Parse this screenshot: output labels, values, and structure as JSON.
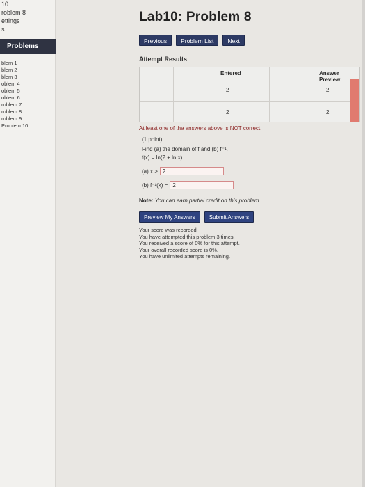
{
  "sidebar": {
    "top_lines": [
      "10",
      "roblem 8",
      "ettings",
      "s"
    ],
    "problems_header": "Problems",
    "items": [
      "blem 1",
      "blem 2",
      "blem 3",
      "oblem 4",
      "oblem 5",
      "oblem 6",
      "roblem 7",
      "roblem 8",
      "roblem 9",
      "Problem 10"
    ]
  },
  "main": {
    "title": "Lab10: Problem 8",
    "nav": {
      "previous": "Previous",
      "problem_list": "Problem List",
      "next": "Next"
    },
    "attempt_header": "Attempt Results",
    "results": {
      "col_entered": "Entered",
      "col_preview": "Answer Preview",
      "rows": [
        {
          "entered": "2",
          "preview": "2"
        },
        {
          "entered": "2",
          "preview": "2"
        }
      ]
    },
    "warning": "At least one of the answers above is NOT correct.",
    "problem": {
      "points": "(1 point)",
      "line1": "Find (a) the domain of f and (b) f⁻¹.",
      "line2": "f(x) = ln(2 + ln x)",
      "a_label": "(a) x >",
      "a_value": "2",
      "b_label": "(b) f⁻¹(x) =",
      "b_value": "2"
    },
    "note_bold": "Note:",
    "note_text": "You can earn partial credit on this problem.",
    "buttons": {
      "preview": "Preview My Answers",
      "submit": "Submit Answers"
    },
    "score_lines": [
      "Your score was recorded.",
      "You have attempted this problem 3 times.",
      "You received a score of 0% for this attempt.",
      "Your overall recorded score is 0%.",
      "You have unlimited attempts remaining."
    ]
  }
}
